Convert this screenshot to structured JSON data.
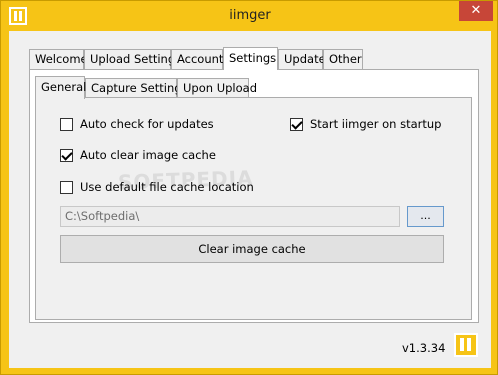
{
  "window": {
    "title": "iimger",
    "close_symbol": "✕",
    "app_icon": "app-logo-icon"
  },
  "tabs": [
    {
      "label": "Welcome",
      "active": false
    },
    {
      "label": "Upload Settings",
      "active": false
    },
    {
      "label": "Account",
      "active": false
    },
    {
      "label": "Settings",
      "active": true
    },
    {
      "label": "Update",
      "active": false
    },
    {
      "label": "Other",
      "active": false
    }
  ],
  "subtabs": [
    {
      "label": "General",
      "active": true
    },
    {
      "label": "Capture Settings",
      "active": false
    },
    {
      "label": "Upon Upload",
      "active": false
    }
  ],
  "general": {
    "auto_check_updates": {
      "label": "Auto check for updates",
      "checked": false
    },
    "start_on_startup": {
      "label": "Start iimger on startup",
      "checked": true
    },
    "auto_clear_cache": {
      "label": "Auto clear image cache",
      "checked": true
    },
    "default_cache_location": {
      "label": "Use default file cache location",
      "checked": false
    },
    "cache_path": {
      "value": "C:\\Softpedia\\"
    },
    "browse_label": "...",
    "clear_cache_label": "Clear image cache"
  },
  "footer": {
    "version": "v1.3.34"
  },
  "colors": {
    "brand": "#f6c416",
    "close": "#c74638"
  }
}
